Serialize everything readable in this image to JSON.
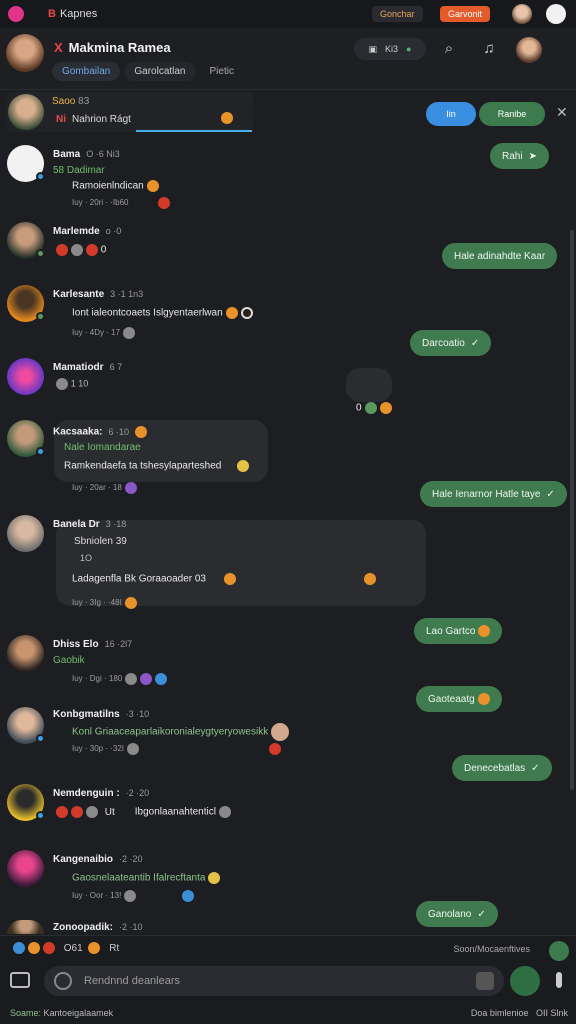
{
  "statusbar": {
    "app_prefix": "B",
    "title": "Kapnes",
    "chip1": "Gonchar",
    "chip2": "Garvonit"
  },
  "header": {
    "name_prefix": "X",
    "name": "Makmina Ramea",
    "tabs": [
      "Gombailan",
      "Garolcatlan",
      "Pietic"
    ],
    "call_label": "Ki3",
    "icons": [
      "call-icon",
      "search-icon",
      "bell-icon"
    ]
  },
  "reply": {
    "name": "Saoo",
    "count": "83",
    "prefix": "Ni",
    "text": "Nahrion Rágt",
    "pill_left": "Iin",
    "pill_right": "Ranibe"
  },
  "messages": [
    {
      "name": "Bama",
      "time": "O ·6 Ni3",
      "sub": "58 Dadimar",
      "text": "Ramoienlndican",
      "meta": "Iuy · 20ri · ·Ib60"
    },
    {
      "name": "Marlemde",
      "time": "o ·0",
      "sub": "",
      "text": "0",
      "meta": ""
    },
    {
      "name": "Karlesante",
      "time": "3 ·1 1n3",
      "sub": "",
      "text": "Iont ialeontcoaets Islgyentaerlwan",
      "meta": "Iuy · 4Dy · 17"
    },
    {
      "name": "Mamatiodr",
      "time": "6 7",
      "sub": "",
      "text": "",
      "meta": ""
    },
    {
      "name": "Kacsaaka:",
      "time": "6 ·10",
      "sub": "Nale Iomandarae",
      "text": "Ramkendaefa ta tshesylaparteshed",
      "meta": "Iuy · 20ar · 18"
    },
    {
      "name": "Banela Dr",
      "time": "3 ·18",
      "sub": "Sbniolen 39",
      "text": "Ladagenfla  Bk  Goraaoader  03",
      "meta": "Iuy · 3Ig · ·48I",
      "extra": "1O"
    },
    {
      "name": "Dhiss Elo",
      "time": "16 ·2l7",
      "sub": "Gaobik",
      "text": "",
      "meta": "Iuy · Dgi · 180"
    },
    {
      "name": "Konbgmatilns",
      "time": "·3 ·10",
      "sub": "",
      "text": "Konl Griaaceaparlaikoronialeygtyeryowesikk",
      "meta": "Iuy · 30p · ·32I"
    },
    {
      "name": "Nemdenguin :",
      "time": "·2 ·20",
      "sub": "",
      "text": "Ibgonlaanahtenticl",
      "meta": "Ut"
    },
    {
      "name": "Kangenaibio",
      "time": "·2 ·20",
      "sub": "",
      "text": "Gaosnelaateantib Ifalrecftanta",
      "meta": "Iuy · Oor · 13!"
    },
    {
      "name": "Zonoopadik:",
      "time": "·2 ·10",
      "sub": "",
      "text": "",
      "meta": ""
    }
  ],
  "outgoing": [
    "Rahi",
    "Hale adinahdte Kaar",
    "Darcoatio",
    "Hale Ienarnor Hatle taye",
    "Lao Gartco",
    "Gaoteaatg",
    "Denecebatlas",
    "Ganolano"
  ],
  "misc": {
    "small_count": "0"
  },
  "input": {
    "reaction_label": "O61",
    "reaction_tail": "Rt",
    "reaction_right": "Soon/Mocaenftives",
    "placeholder": "Rendnnd deanlears"
  },
  "footer": {
    "left_label": "Soame:",
    "left_text": "Kantoeigalaamek",
    "right_label": "Doa bimlenioe",
    "right_tail": "OII Slnk"
  },
  "colors": {
    "accent_green": "#3f7b4f",
    "accent_blue": "#3a8ee0",
    "background": "#1d1e21"
  }
}
